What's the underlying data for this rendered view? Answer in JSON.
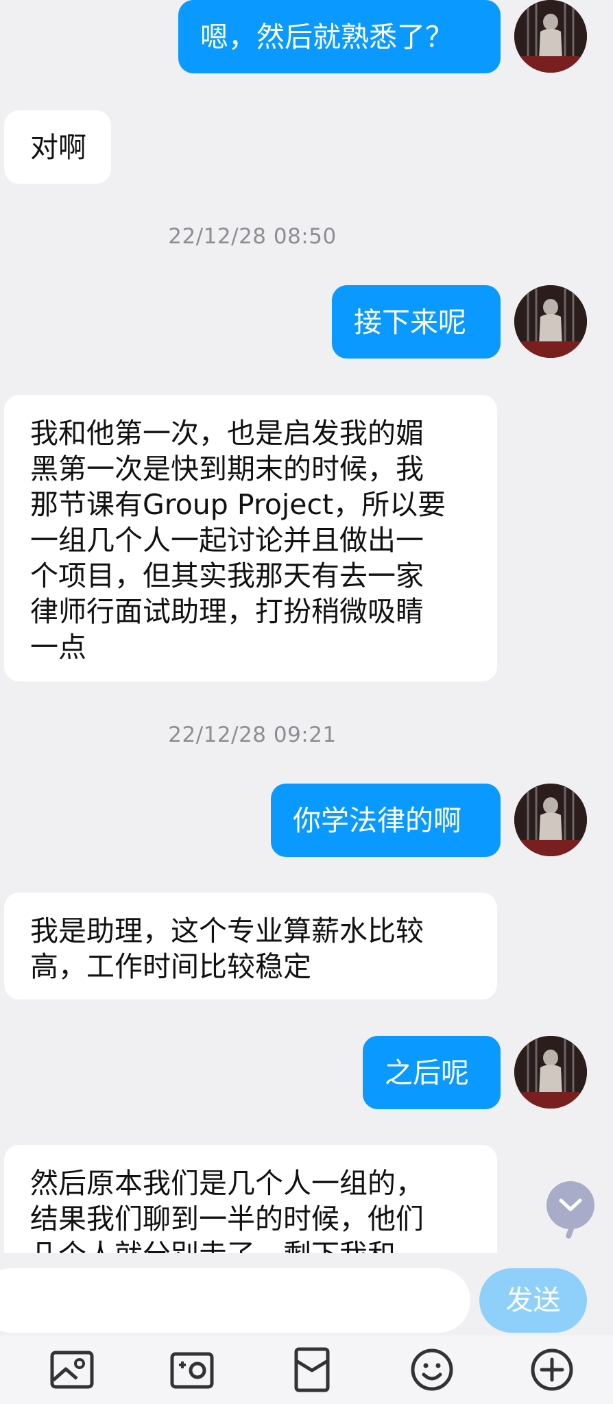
{
  "messages": [
    {
      "type": "out",
      "text": "嗯，然后就熟悉了？"
    },
    {
      "type": "in",
      "text": "对啊"
    },
    {
      "type": "time",
      "text": "22/12/28 08:50"
    },
    {
      "type": "out",
      "text": "接下来呢"
    },
    {
      "type": "in",
      "text": "我和他第一次，也是启发我的媚\n黑第一次是快到期末的时候，我\n那节课有Group Project，所以要\n一组几个人一起讨论并且做出一\n个项目，但其实我那天有去一家\n律师行面试助理，打扮稍微吸睛\n一点"
    },
    {
      "type": "time",
      "text": "22/12/28 09:21"
    },
    {
      "type": "out",
      "text": "你学法律的啊"
    },
    {
      "type": "in",
      "text": "我是助理，这个专业算薪水比较\n高，工作时间比较稳定"
    },
    {
      "type": "out",
      "text": "之后呢"
    },
    {
      "type": "in",
      "text": "然后原本我们是几个人一组的，\n结果我们聊到一半的时候，他们\n几个人就分别走了，剩下我和"
    }
  ],
  "composer": {
    "input_value": "",
    "input_placeholder": "",
    "send_label": "发送"
  },
  "toolbar_icons": [
    "image-icon",
    "camera-icon",
    "red-packet-icon",
    "emoji-icon",
    "plus-icon"
  ],
  "colors": {
    "outgoing_bubble": "#0a99ff",
    "incoming_bubble": "#ffffff",
    "background": "#f0f0f2",
    "send_button": "#8fd0fb",
    "scroll_button": "#a8acc8"
  }
}
